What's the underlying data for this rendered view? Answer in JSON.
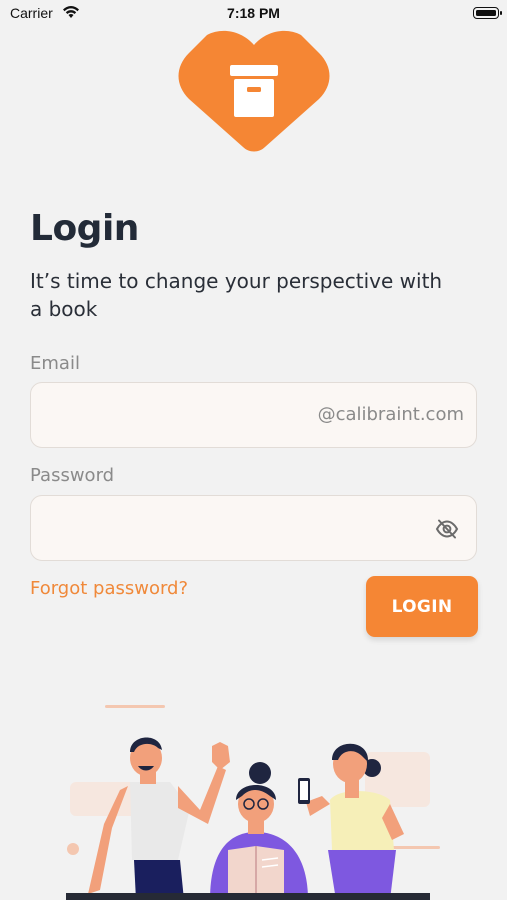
{
  "status_bar": {
    "carrier": "Carrier",
    "time": "7:18 PM"
  },
  "logo": {
    "icon": "archive-box-icon",
    "color": "#f58634"
  },
  "header": {
    "title": "Login",
    "subtitle": "It’s time to change your perspective with a book"
  },
  "form": {
    "email_label": "Email",
    "email_value": "",
    "email_suffix": "@calibraint.com",
    "password_label": "Password",
    "password_value": "",
    "forgot_password": "Forgot password?",
    "login_button": "LOGIN"
  },
  "colors": {
    "accent": "#f58634",
    "background": "#f2f2f2",
    "input_background": "#fbf7f4"
  },
  "illustration": {
    "description_icon": "people-reading-illustration"
  }
}
